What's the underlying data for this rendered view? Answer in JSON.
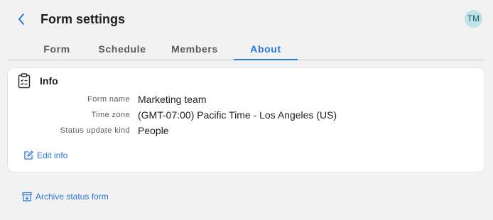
{
  "header": {
    "title": "Form settings",
    "avatar_initials": "TM"
  },
  "tabs": [
    {
      "label": "Form",
      "active": false
    },
    {
      "label": "Schedule",
      "active": false
    },
    {
      "label": "Members",
      "active": false
    },
    {
      "label": "About",
      "active": true
    }
  ],
  "info": {
    "title": "Info",
    "fields": [
      {
        "label": "Form name",
        "value": "Marketing team"
      },
      {
        "label": "Time zone",
        "value": "(GMT-07:00) Pacific Time - Los Angeles (US)"
      },
      {
        "label": "Status update kind",
        "value": "People"
      }
    ],
    "edit_label": "Edit info"
  },
  "archive_label": "Archive status form",
  "colors": {
    "accent": "#2a78d8",
    "avatar_bg": "#bfe3ea",
    "background": "#f2f2f3"
  }
}
